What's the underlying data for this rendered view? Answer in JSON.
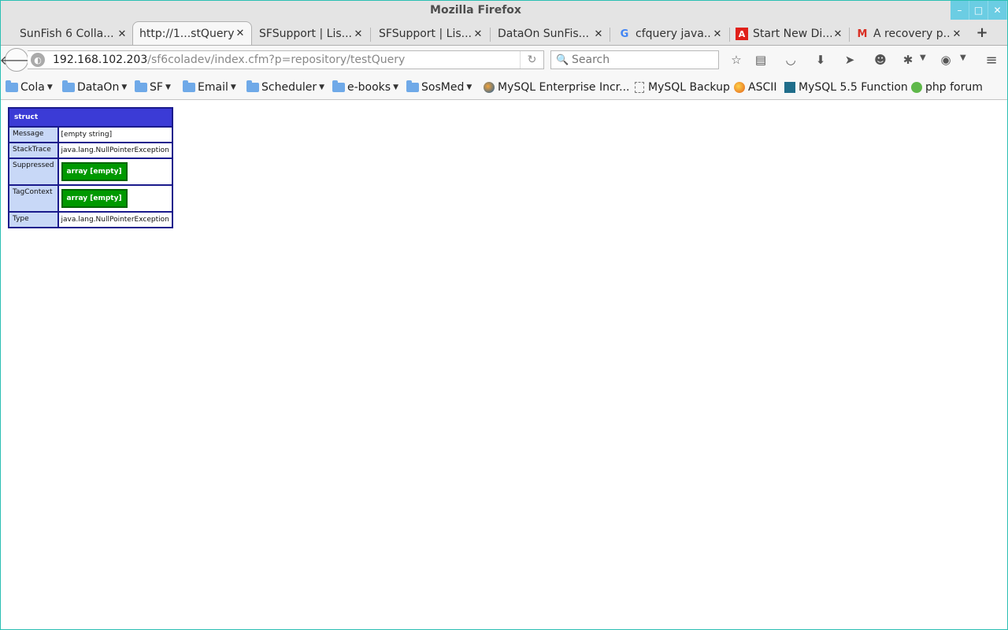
{
  "window": {
    "title": "Mozilla Firefox",
    "controls": {
      "minimize": "–",
      "maximize": "□",
      "close": "✕"
    }
  },
  "tabs": [
    {
      "label": "SunFish 6 Colla...",
      "active": false,
      "icon": "none"
    },
    {
      "label": "http://1...stQuery",
      "active": true,
      "icon": "none"
    },
    {
      "label": "SFSupport | Lis...",
      "active": false,
      "icon": "none"
    },
    {
      "label": "SFSupport | Lis...",
      "active": false,
      "icon": "none"
    },
    {
      "label": "DataOn SunFis...",
      "active": false,
      "icon": "none"
    },
    {
      "label": "cfquery java...",
      "active": false,
      "icon": "google-icon"
    },
    {
      "label": "Start New Di...",
      "active": false,
      "icon": "adobe-icon"
    },
    {
      "label": "A recovery p...",
      "active": false,
      "icon": "gmail-icon"
    }
  ],
  "tab_close_glyph": "✕",
  "new_tab_glyph": "+",
  "navbar": {
    "url_host": "192.168.102.203",
    "url_path": "/sf6coladev/index.cfm?p=repository/testQuery",
    "search_placeholder": "Search"
  },
  "bookmarks": [
    {
      "label": "Cola",
      "type": "folder"
    },
    {
      "label": "DataOn",
      "type": "folder"
    },
    {
      "label": "SF",
      "type": "folder"
    },
    {
      "label": "Email",
      "type": "folder"
    },
    {
      "label": "Scheduler",
      "type": "folder"
    },
    {
      "label": "e-books",
      "type": "folder"
    },
    {
      "label": "SosMed",
      "type": "folder"
    },
    {
      "label": "MySQL Enterprise Incr...",
      "type": "link"
    },
    {
      "label": "MySQL Backup",
      "type": "link"
    },
    {
      "label": "ASCII",
      "type": "link"
    },
    {
      "label": "MySQL 5.5 Function",
      "type": "link"
    },
    {
      "label": "php forum",
      "type": "link"
    }
  ],
  "dump": {
    "header": "struct",
    "rows": [
      {
        "key": "Message",
        "value": "[empty string]"
      },
      {
        "key": "StackTrace",
        "value": "java.lang.NullPointerException"
      },
      {
        "key": "Suppressed",
        "value": "array [empty]"
      },
      {
        "key": "TagContext",
        "value": "array [empty]"
      },
      {
        "key": "Type",
        "value": "java.lang.NullPointerException"
      }
    ]
  },
  "colors": {
    "struct_header": "#3b3bd6",
    "struct_border": "#1a1a8c",
    "key_cell": "#c8d8f7",
    "array_box": "#009900",
    "window_controls": "#6bcde3"
  }
}
